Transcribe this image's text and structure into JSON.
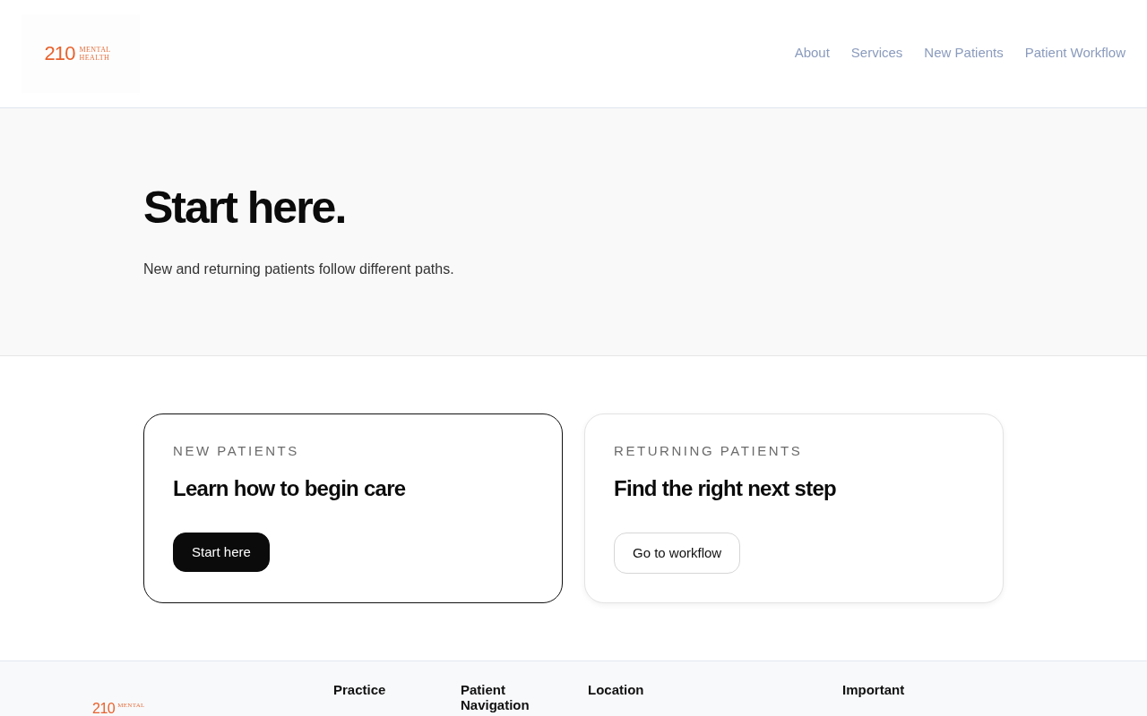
{
  "header": {
    "logo": {
      "number": "210",
      "wordmark": "MENTAL HEALTH"
    },
    "nav": [
      {
        "label": "About"
      },
      {
        "label": "Services"
      },
      {
        "label": "New Patients"
      },
      {
        "label": "Patient Workflow"
      }
    ]
  },
  "hero": {
    "title": "Start here.",
    "subtitle": "New and returning patients follow different paths."
  },
  "cards": [
    {
      "eyebrow": "NEW PATIENTS",
      "title": "Learn how to begin care",
      "selected": true,
      "button": {
        "label": "Start here",
        "kind": "primary"
      }
    },
    {
      "eyebrow": "RETURNING PATIENTS",
      "title": "Find the right next step",
      "selected": false,
      "button": {
        "label": "Go to workflow",
        "kind": "secondary"
      }
    }
  ],
  "footer": {
    "logo": {
      "number": "210",
      "wordmark": "MENTAL"
    },
    "columns": [
      {
        "heading": "Practice"
      },
      {
        "heading": "Patient Navigation"
      },
      {
        "heading": "Location"
      },
      {
        "heading": "Important"
      }
    ]
  }
}
